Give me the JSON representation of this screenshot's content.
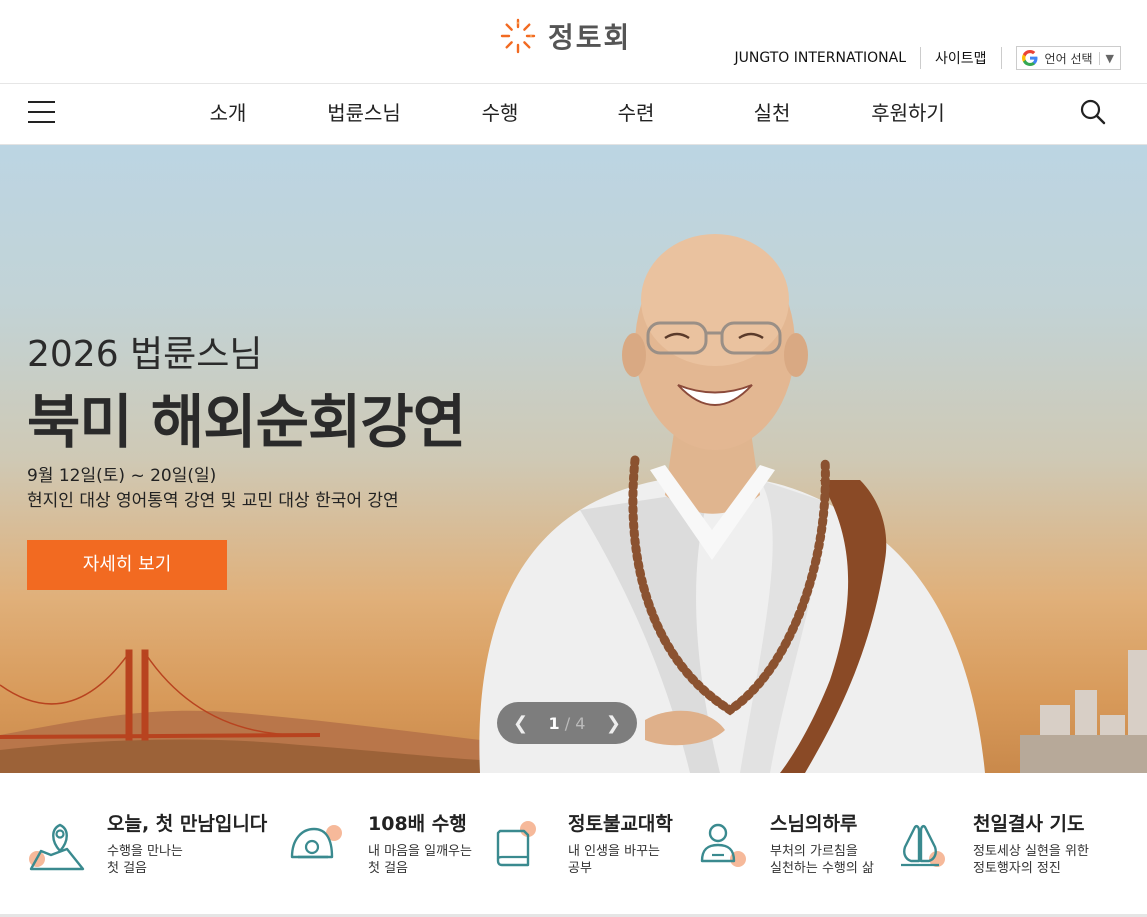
{
  "brand": {
    "name": "정토회",
    "accent": "#f26a21",
    "teal": "#3a8a8f"
  },
  "utility": {
    "international": "JUNGTO INTERNATIONAL",
    "sitemap": "사이트맵",
    "language": "언어 선택",
    "language_caret": "▼"
  },
  "nav": {
    "items": [
      "소개",
      "법륜스님",
      "수행",
      "수련",
      "실천",
      "후원하기"
    ]
  },
  "hero": {
    "subtitle": "2026 법륜스님",
    "title": "북미 해외순회강연",
    "date": "9월 12일(토) ~ 20일(일)",
    "description": "현지인 대상 영어통역 강연 및 교민 대상 한국어 강연",
    "button": "자세히 보기",
    "slide_current": "1",
    "slide_separator": "/",
    "slide_total": "4"
  },
  "quick_links": [
    {
      "title": "오늘, 첫 만남입니다",
      "desc": "수행을 만나는\n첫 걸음",
      "icon": "map-pin-icon"
    },
    {
      "title": "108배 수행",
      "desc": "내 마음을 일깨우는\n첫 걸음",
      "icon": "bowing-icon"
    },
    {
      "title": "정토불교대학",
      "desc": "내 인생을 바꾸는\n공부",
      "icon": "book-icon"
    },
    {
      "title": "스님의하루",
      "desc": "부처의 가르침을\n실천하는 수행의 삶",
      "icon": "monk-icon"
    },
    {
      "title": "천일결사 기도",
      "desc": "정토세상 실현을 위한\n정토행자의 정진",
      "icon": "praying-hands-icon"
    }
  ]
}
